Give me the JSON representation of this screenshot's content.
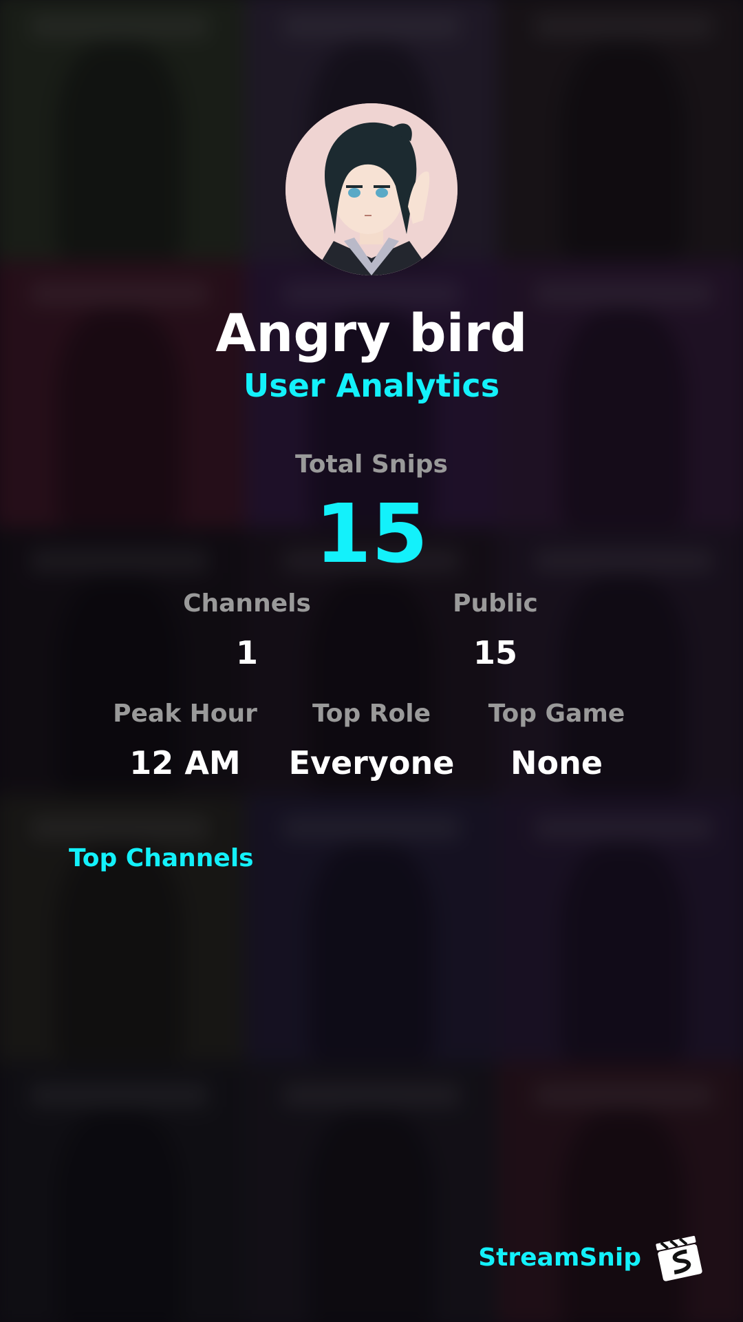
{
  "profile": {
    "username": "Angry bird",
    "subtitle": "User Analytics",
    "avatar_icon": "anime-character-avatar"
  },
  "totals": {
    "label": "Total Snips",
    "value": "15"
  },
  "stats_row_1": {
    "channels": {
      "label": "Channels",
      "value": "1"
    },
    "public": {
      "label": "Public",
      "value": "15"
    }
  },
  "stats_row_2": {
    "peak_hour": {
      "label": "Peak Hour",
      "value": "12 AM"
    },
    "top_role": {
      "label": "Top Role",
      "value": "Everyone"
    },
    "top_game": {
      "label": "Top Game",
      "value": "None"
    }
  },
  "sections": {
    "top_channels": "Top Channels"
  },
  "brand": {
    "name": "StreamSnip",
    "logo_icon": "clapperboard-s-icon"
  },
  "colors": {
    "accent": "#13f1fb",
    "label_gray": "#9a9a9a",
    "text_white": "#ffffff"
  },
  "background_tiles": [
    "#2f3a24",
    "#3a2f44",
    "#2a2222",
    "#4a1a28",
    "#3a1e4a",
    "#3b1f3f",
    "#1a1418",
    "#221820",
    "#2a1d2e",
    "#2a2a1e",
    "#26203a",
    "#2e1e3c",
    "#1a1a1c",
    "#1f1c22",
    "#3a1a22"
  ]
}
